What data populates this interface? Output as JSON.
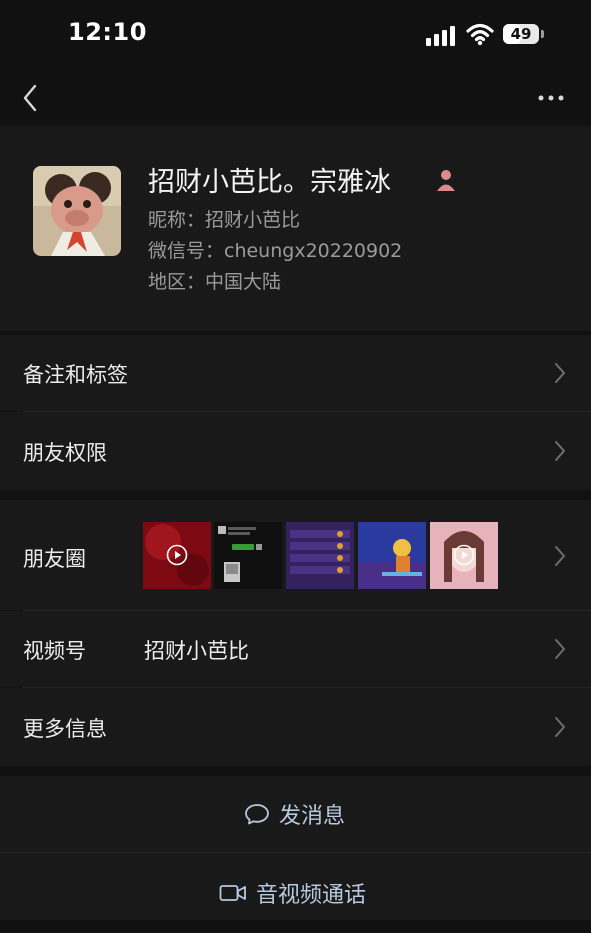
{
  "status_bar": {
    "time": "12:10",
    "battery_level": "49",
    "battery_fraction": 0.49,
    "icons": [
      "signal-icon",
      "wifi-icon",
      "battery-icon"
    ]
  },
  "nav": {
    "back_icon": "chevron-left-icon",
    "more_icon": "more-dots-icon"
  },
  "profile": {
    "display_name": "招财小芭比。宗雅冰",
    "gender_icon": "female-icon",
    "nickname": "昵称：招财小芭比",
    "wechat_id": "微信号：cheungx20220902",
    "region": "地区：中国大陆"
  },
  "menu": {
    "remark_tags": "备注和标签",
    "friend_permissions": "朋友权限",
    "moments": "朋友圈",
    "channels": "视频号",
    "channels_value": "招财小芭比",
    "more_info": "更多信息"
  },
  "moments_thumbnails": [
    {
      "kind": "video",
      "desc": "red-scene"
    },
    {
      "kind": "image",
      "desc": "chat-screenshot"
    },
    {
      "kind": "image",
      "desc": "game-list"
    },
    {
      "kind": "image",
      "desc": "game-character"
    },
    {
      "kind": "video",
      "desc": "portrait"
    }
  ],
  "actions": {
    "send_message": "发消息",
    "av_call": "音视频通话"
  },
  "colors": {
    "background": "#111111",
    "card": "#191919",
    "action_text": "#b6c9de",
    "secondary_text": "#9a9a9a"
  }
}
